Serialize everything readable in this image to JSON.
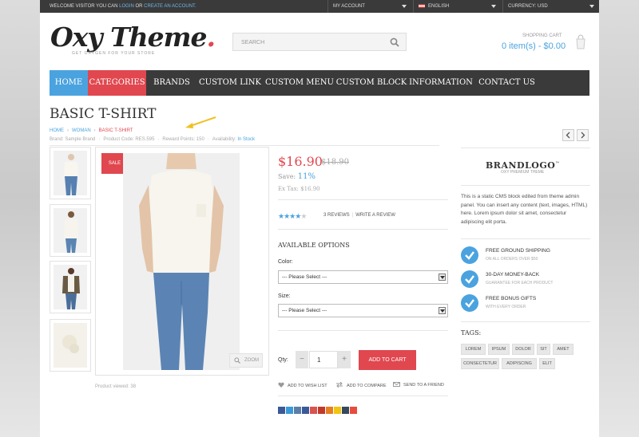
{
  "topbar": {
    "welcome_prefix": "Welcome visitor you can",
    "login": "login",
    "or": "or",
    "create_account": "create an account.",
    "account": "My Account",
    "language": "English",
    "currency": "Currency: USD"
  },
  "header": {
    "logo_main": "Oxy Theme",
    "logo_dot": ".",
    "tagline": "Get Oxygen for your store",
    "search_placeholder": "Search",
    "cart_label": "Shopping Cart",
    "cart_value": "0 item(s) - $0.00"
  },
  "nav": [
    "Home",
    "Categories",
    "Brands",
    "Custom Link",
    "Custom Menu",
    "Custom Block",
    "Information",
    "Contact Us"
  ],
  "product": {
    "title": "Basic T-Shirt",
    "breadcrumb": [
      "Home",
      "Woman",
      "Basic T-Shirt"
    ],
    "meta": {
      "brand": "Brand: Sample Brand",
      "code": "Product Code: RES.595",
      "points": "Reward Points: 150",
      "availability_label": "Availability:",
      "availability": "In Stock"
    },
    "sale_badge": "Sale",
    "zoom": "Zoom",
    "viewed": "Product viewed: 38",
    "price": "$16.90",
    "old_price": "$18.90",
    "save_label": "Save:",
    "save_pct": "11%",
    "ex_tax": "Ex Tax: $16.90",
    "rating": 4,
    "rating_max": 5,
    "reviews": "3 Reviews",
    "write_review": "Write a review",
    "options_title": "Available Options",
    "color_label": "Color:",
    "color_value": "--- Please Select ---",
    "size_label": "Size:",
    "size_value": "--- Please Select ---",
    "qty_label": "Qty:",
    "qty_minus": "−",
    "qty_value": "1",
    "qty_plus": "+",
    "add_to_cart": "Add to Cart",
    "wishlist": "Add to Wish List",
    "compare": "Add to Compare",
    "send_friend": "Send to a Friend"
  },
  "sidebar": {
    "brand_logo": "BRANDLOGO",
    "brand_tm": "™",
    "brand_sub": "Oxy Premium Theme",
    "cms_text": "This is a static CMS block edited from theme admin panel. You can insert any content (text, images, HTML) here. Lorem ipsum dolor sit amet, consectetur adipiscing elit porta.",
    "features": [
      {
        "title": "Free Ground Shipping",
        "subtitle": "On all orders over $50"
      },
      {
        "title": "30-Day Money-Back",
        "subtitle": "Guarantee for each product"
      },
      {
        "title": "Free Bonus Gifts",
        "subtitle": "With every order"
      }
    ],
    "tags_title": "Tags:",
    "tags": [
      "Lorem",
      "Ipsum",
      "Dolor",
      "Sit",
      "Amet",
      "Consectetur",
      "Adipiscing",
      "Elit"
    ]
  },
  "colors": {
    "accent_blue": "#4aa3df",
    "accent_red": "#e0474f",
    "dark": "#3a3a3a",
    "arrow_annotation": "#f0c020"
  },
  "icons": [
    "search-icon",
    "bag-icon",
    "chevron-left-icon",
    "chevron-right-icon",
    "zoom-icon",
    "heart-icon",
    "compare-icon",
    "mail-icon",
    "check-icon",
    "star-icon",
    "annotation-arrow-icon"
  ]
}
